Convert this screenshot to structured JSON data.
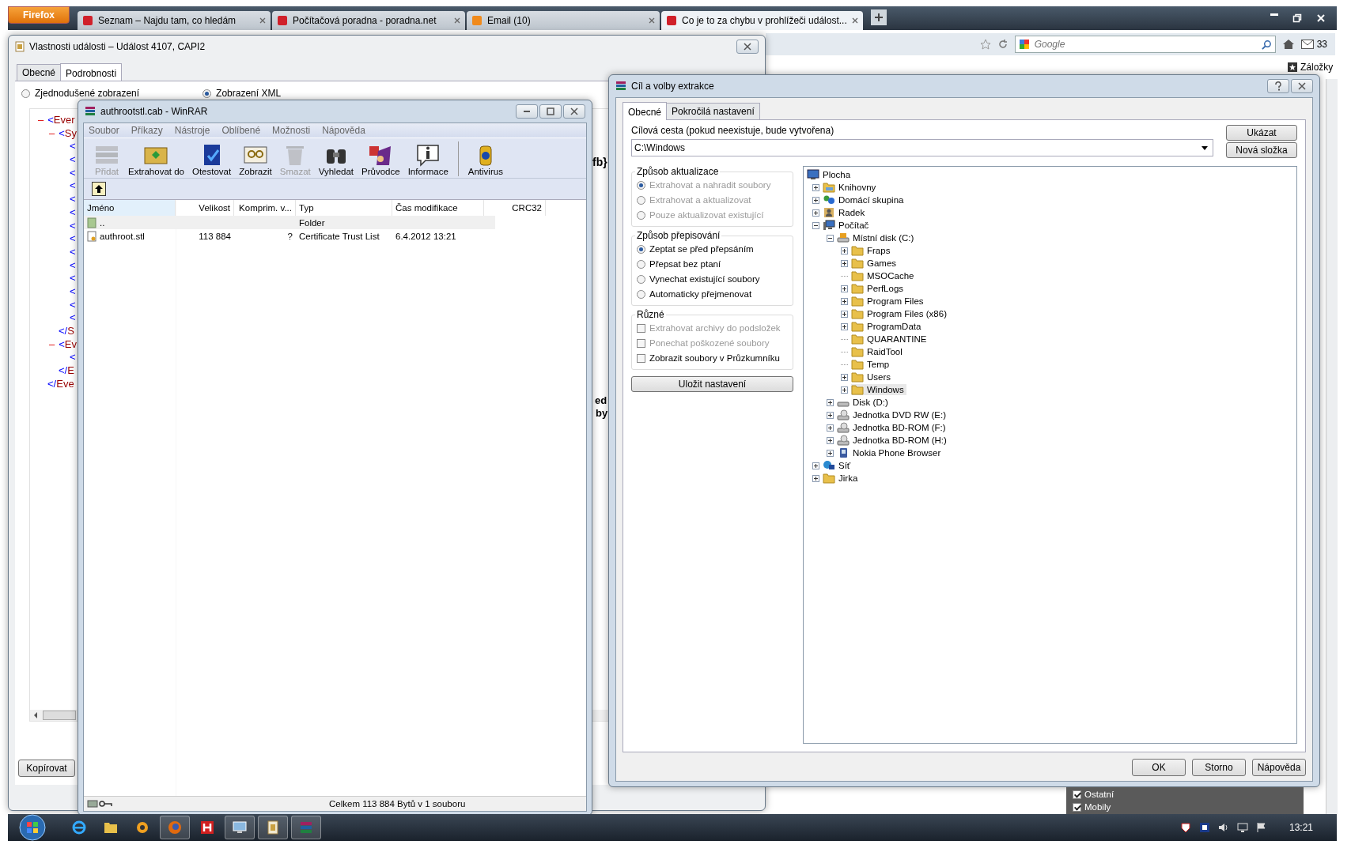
{
  "browser": {
    "app_button": "Firefox",
    "tabs": [
      {
        "label": "Seznam – Najdu tam, co hledám",
        "selected": false
      },
      {
        "label": "Počítačová poradna - poradna.net",
        "selected": false
      },
      {
        "label": "Email (10)",
        "selected": false
      },
      {
        "label": "Co je to za chybu v prohlížeči událost...",
        "selected": true
      }
    ],
    "search_placeholder": "Google",
    "mail_count": "33",
    "bookmarks": "Záložky"
  },
  "event_window": {
    "title": "Vlastnosti události – Událost 4107, CAPI2",
    "tabs": [
      {
        "label": "Obecné",
        "selected": false
      },
      {
        "label": "Podrobnosti",
        "selected": true
      }
    ],
    "view_options": [
      {
        "label": "Zjednodušené zobrazení",
        "selected": false
      },
      {
        "label": "Zobrazení XML",
        "selected": true
      }
    ],
    "xml": [
      {
        "toggle": "–",
        "bracket": "<",
        "name": "Ever",
        "children": [
          {
            "toggle": "–",
            "bracket": "<",
            "name": "Sy",
            "children": [
              {
                "bracket": "<"
              },
              {
                "bracket": "<"
              },
              {
                "bracket": "<"
              },
              {
                "bracket": "<"
              },
              {
                "bracket": "<"
              },
              {
                "bracket": "<"
              },
              {
                "bracket": "<"
              },
              {
                "bracket": "<"
              },
              {
                "bracket": "<"
              },
              {
                "bracket": "<"
              },
              {
                "bracket": "<"
              },
              {
                "bracket": "<"
              },
              {
                "bracket": "<"
              },
              {
                "bracket": "<"
              }
            ]
          },
          {
            "bracket": "</",
            "name": "S"
          },
          {
            "toggle": "–",
            "bracket": "<",
            "name": "Ev",
            "children": [
              {
                "bracket": "<"
              }
            ]
          },
          {
            "bracket": "</",
            "name": "E"
          }
        ]
      },
      {
        "bracket": "</",
        "name": "Eve"
      }
    ],
    "fragments": [
      "fb}",
      "ed",
      "by"
    ],
    "copy_button": "Kopírovat"
  },
  "winrar": {
    "title": "authrootstl.cab - WinRAR",
    "menu": [
      "Soubor",
      "Příkazy",
      "Nástroje",
      "Oblíbené",
      "Možnosti",
      "Nápověda"
    ],
    "toolbar": [
      {
        "label": "Přidat",
        "disabled": true
      },
      {
        "label": "Extrahovat do",
        "disabled": false
      },
      {
        "label": "Otestovat",
        "disabled": false
      },
      {
        "label": "Zobrazit",
        "disabled": false
      },
      {
        "label": "Smazat",
        "disabled": true
      },
      {
        "label": "Vyhledat",
        "disabled": false
      },
      {
        "label": "Průvodce",
        "disabled": false
      },
      {
        "label": "Informace",
        "disabled": false
      },
      {
        "label": "Antivirus",
        "disabled": false
      }
    ],
    "columns": [
      "Jméno",
      "Velikost",
      "Komprim. v...",
      "Typ",
      "Čas modifikace",
      "CRC32"
    ],
    "rows": [
      {
        "kind": "folder",
        "name": "..",
        "type": "Folder",
        "selected": true
      },
      {
        "kind": "file",
        "name": "authroot.stl",
        "size": "113 884",
        "packed": "?",
        "type": "Certificate Trust List",
        "modified": "6.4.2012 13:21",
        "selected": false
      }
    ],
    "status": "Celkem 113 884 Bytů v 1 souboru"
  },
  "extract_dialog": {
    "title": "Cíl a volby extrakce",
    "tabs": [
      {
        "label": "Obecné",
        "selected": true
      },
      {
        "label": "Pokročilá nastavení",
        "selected": false
      }
    ],
    "path_label": "Cílová cesta (pokud neexistuje, bude vytvořena)",
    "path_value": "C:\\Windows",
    "side_buttons": [
      "Ukázat",
      "Nová složka"
    ],
    "update_mode": {
      "title": "Způsob aktualizace",
      "options": [
        {
          "label": "Extrahovat a nahradit soubory",
          "selected": true,
          "disabled": true
        },
        {
          "label": "Extrahovat a aktualizovat",
          "selected": false,
          "disabled": true
        },
        {
          "label": "Pouze aktualizovat existující",
          "selected": false,
          "disabled": true
        }
      ]
    },
    "overwrite_mode": {
      "title": "Způsob přepisování",
      "options": [
        {
          "label": "Zeptat se před přepsáním",
          "selected": true,
          "disabled": false
        },
        {
          "label": "Přepsat bez ptaní",
          "selected": false,
          "disabled": false
        },
        {
          "label": "Vynechat existující soubory",
          "selected": false,
          "disabled": false
        },
        {
          "label": "Automaticky přejmenovat",
          "selected": false,
          "disabled": false
        }
      ]
    },
    "misc": {
      "title": "Různé",
      "options": [
        {
          "label": "Extrahovat archivy do podsložek",
          "checked": false,
          "disabled": true
        },
        {
          "label": "Ponechat poškozené soubory",
          "checked": false,
          "disabled": true
        },
        {
          "label": "Zobrazit soubory v Průzkumníku",
          "checked": false,
          "disabled": false
        }
      ]
    },
    "save_button": "Uložit nastavení",
    "tree": [
      {
        "kind": "desktop",
        "label": "Plocha",
        "selected": false,
        "children": [
          {
            "kind": "library",
            "label": "Knihovny",
            "expanded": false,
            "selected": false
          },
          {
            "kind": "group",
            "label": "Domácí skupina",
            "expanded": false,
            "selected": false
          },
          {
            "kind": "user",
            "label": "Radek",
            "expanded": false,
            "selected": false
          },
          {
            "kind": "computer",
            "label": "Počítač",
            "expanded": true,
            "selected": false,
            "children": [
              {
                "kind": "system-drive",
                "label": "Místní disk (C:)",
                "expanded": true,
                "selected": false,
                "children": [
                  {
                    "kind": "folder",
                    "label": "Fraps",
                    "expanded": false,
                    "selected": false
                  },
                  {
                    "kind": "folder",
                    "label": "Games",
                    "expanded": false,
                    "selected": false
                  },
                  {
                    "kind": "folder",
                    "label": "MSOCache",
                    "selected": false
                  },
                  {
                    "kind": "folder",
                    "label": "PerfLogs",
                    "expanded": false,
                    "selected": false
                  },
                  {
                    "kind": "folder",
                    "label": "Program Files",
                    "expanded": false,
                    "selected": false
                  },
                  {
                    "kind": "folder",
                    "label": "Program Files (x86)",
                    "expanded": false,
                    "selected": false
                  },
                  {
                    "kind": "folder",
                    "label": "ProgramData",
                    "expanded": false,
                    "selected": false
                  },
                  {
                    "kind": "folder",
                    "label": "QUARANTINE",
                    "selected": false
                  },
                  {
                    "kind": "folder",
                    "label": "RaidTool",
                    "selected": false
                  },
                  {
                    "kind": "folder",
                    "label": "Temp",
                    "selected": false
                  },
                  {
                    "kind": "folder",
                    "label": "Users",
                    "expanded": false,
                    "selected": false
                  },
                  {
                    "kind": "folder",
                    "label": "Windows",
                    "expanded": false,
                    "selected": true
                  }
                ]
              },
              {
                "kind": "drive",
                "label": "Disk (D:)",
                "expanded": false,
                "selected": false
              },
              {
                "kind": "optical",
                "label": "Jednotka DVD RW (E:)",
                "expanded": false,
                "selected": false
              },
              {
                "kind": "optical",
                "label": "Jednotka BD-ROM (F:)",
                "expanded": false,
                "selected": false
              },
              {
                "kind": "optical",
                "label": "Jednotka BD-ROM (H:)",
                "expanded": false,
                "selected": false
              },
              {
                "kind": "phone",
                "label": "Nokia Phone Browser",
                "expanded": false,
                "selected": false
              }
            ]
          },
          {
            "kind": "network",
            "label": "Síť",
            "expanded": false,
            "selected": false
          },
          {
            "kind": "folder",
            "label": "Jirka",
            "expanded": false,
            "selected": false
          }
        ]
      }
    ],
    "footer_buttons": [
      "OK",
      "Storno",
      "Nápověda"
    ]
  },
  "contacts_panel": [
    {
      "label": "Ostatní",
      "checked": true
    },
    {
      "label": "Mobily",
      "checked": true
    }
  ],
  "taskbar": {
    "clock": "13:21"
  }
}
